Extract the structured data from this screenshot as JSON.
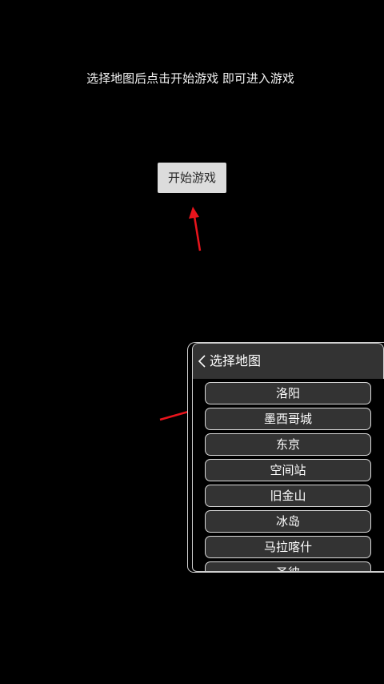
{
  "instruction": "选择地图后点击开始游戏 即可进入游戏",
  "start_button": "开始游戏",
  "map_panel": {
    "title": "选择地图",
    "items": [
      "洛阳",
      "墨西哥城",
      "东京",
      "空间站",
      "旧金山",
      "冰岛",
      "马拉喀什",
      "圣彼"
    ]
  },
  "colors": {
    "background": "#000000",
    "arrow": "#e8141c",
    "button": "#dcdcdc",
    "list_item": "#333333"
  }
}
